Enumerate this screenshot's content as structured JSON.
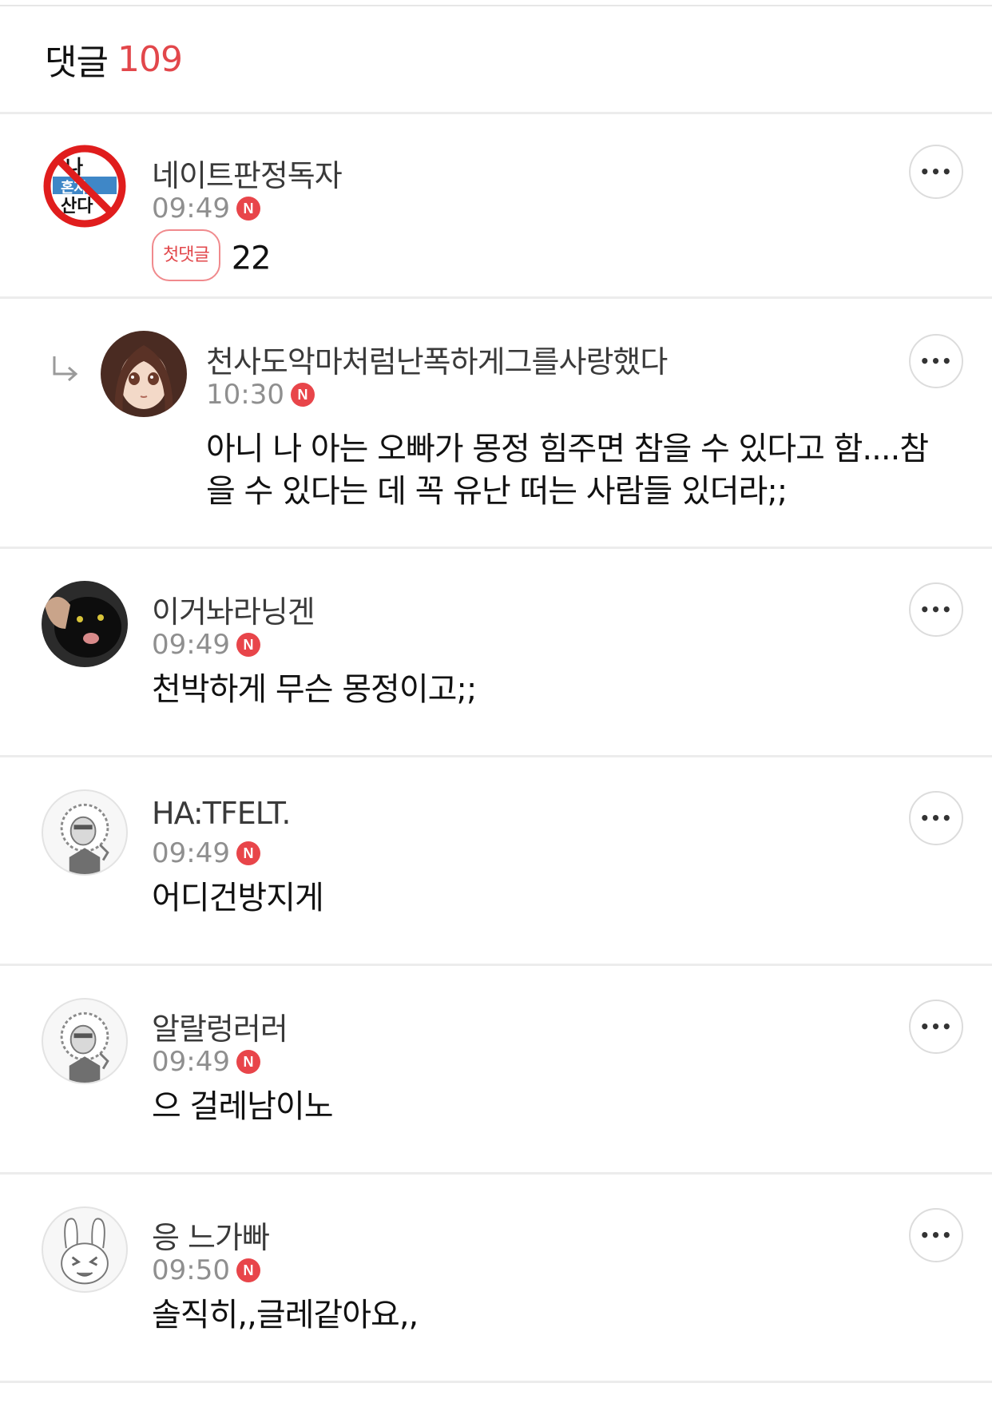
{
  "header": {
    "label": "댓글",
    "count": "109"
  },
  "comments": [
    {
      "name": "네이트판정독자",
      "time": "09:49",
      "badge": "N",
      "first_label": "첫댓글",
      "text": "22",
      "more": "•••"
    },
    {
      "name": "천사도악마처럼난폭하게그를사랑했다",
      "time": "10:30",
      "badge": "N",
      "text_line1": "아니 나 아는 오빠가 몽정 힘주면 참을 수 있다고 함....참",
      "text_line2": "을 수 있다는 데 꼭 유난 떠는 사람들 있더라;;",
      "more": "•••"
    },
    {
      "name": "이거놔라닝겐",
      "time": "09:49",
      "badge": "N",
      "text": "천박하게 무슨 몽정이고;;",
      "more": "•••"
    },
    {
      "name": "HA:TFELT.",
      "time": "09:49",
      "badge": "N",
      "text": "어디건방지게",
      "more": "•••"
    },
    {
      "name": "알랄렁러러",
      "time": "09:49",
      "badge": "N",
      "text": "으 걸레남이노",
      "more": "•••"
    },
    {
      "name": "응 느가빠",
      "time": "09:50",
      "badge": "N",
      "text": "솔직히,,글레같아요,,",
      "more": "•••"
    }
  ],
  "avatar_1_text": [
    "나",
    "혼자",
    "산다"
  ]
}
